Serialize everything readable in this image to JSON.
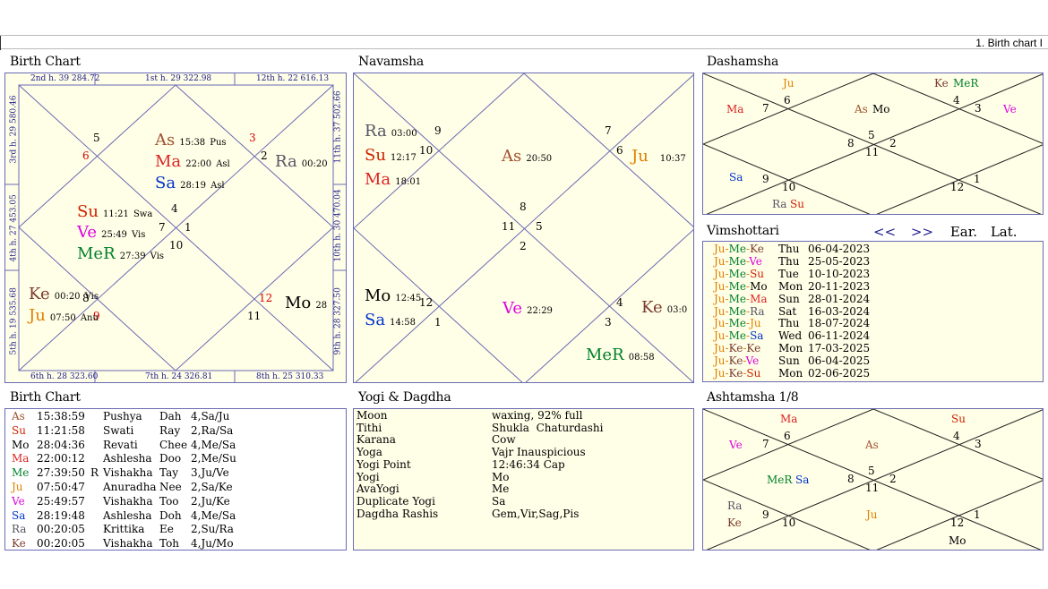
{
  "app": {
    "tab_label": "1. Birth chart I"
  },
  "colors": {
    "As": "#a0522d",
    "Su": "#cc2200",
    "Mo": "#000000",
    "Ma": "#dd2222",
    "Me": "#00802b",
    "Ju": "#e08000",
    "Ve": "#dd00dd",
    "Sa": "#0033cc",
    "Ra": "#555566",
    "Ke": "#7a3b2e",
    "house_red": "#dd0000"
  },
  "birth_chart": {
    "title": "Birth Chart",
    "edge": {
      "top_l": "2nd h. 39 284.72",
      "top_m": "1st h. 29 322.98",
      "top_r": "12th h. 22 616.13",
      "bot_l": "6th h. 28 323.60",
      "bot_m": "7th h. 24 326.81",
      "bot_r": "8th h. 25 310.33",
      "left_t": "3rd h. 29 580.46",
      "left_m": "4th h. 27 453.05",
      "left_b": "5th h. 19 535.68",
      "right_t": "11th h. 37 502.66",
      "right_m": "10th h. 30 470.04",
      "right_b": "9th h. 28 327.50"
    },
    "houses": [
      "5",
      "6",
      "3",
      "2",
      "4",
      "7",
      "1",
      "10",
      "8",
      "9",
      "12",
      "11"
    ],
    "planets": [
      {
        "name": "As",
        "deg": "15:38",
        "nak": "Pus"
      },
      {
        "name": "Ma",
        "deg": "22:00",
        "nak": "Asl"
      },
      {
        "name": "Sa",
        "deg": "28:19",
        "nak": "Asl"
      },
      {
        "name": "Ra",
        "deg": "00:20"
      },
      {
        "name": "Su",
        "deg": "11:21",
        "nak": "Swa"
      },
      {
        "name": "Ve",
        "deg": "25:49",
        "nak": "Vis"
      },
      {
        "name": "MeR",
        "deg": "27:39",
        "nak": "Vis"
      },
      {
        "name": "Ke",
        "deg": "00:20",
        "nak": "Vis"
      },
      {
        "name": "Ju",
        "deg": "07:50",
        "nak": "Anu"
      },
      {
        "name": "Mo",
        "deg": "28"
      }
    ]
  },
  "navamsha": {
    "title": "Navamsha",
    "houses": [
      "9",
      "10",
      "7",
      "6",
      "8",
      "11",
      "5",
      "2",
      "12",
      "1",
      "4",
      "3"
    ],
    "planets": [
      {
        "name": "Ra",
        "deg": "03:00"
      },
      {
        "name": "Su",
        "deg": "12:17"
      },
      {
        "name": "Ma",
        "deg": "18:01"
      },
      {
        "name": "As",
        "deg": "20:50"
      },
      {
        "name": "Ju",
        "deg": "10:37"
      },
      {
        "name": "Mo",
        "deg": "12:45"
      },
      {
        "name": "Sa",
        "deg": "14:58"
      },
      {
        "name": "Ve",
        "deg": "22:29"
      },
      {
        "name": "Ke",
        "deg": "03:0"
      },
      {
        "name": "MeR",
        "deg": "08:58"
      }
    ]
  },
  "dashamsha": {
    "title": "Dashamsha",
    "houses": [
      "6",
      "7",
      "4",
      "3",
      "5",
      "8",
      "2",
      "11",
      "9",
      "10",
      "12",
      "1"
    ],
    "planets": [
      "Ju",
      "Ke",
      "MeR",
      "Ma",
      "As",
      "Mo",
      "Ve",
      "Sa",
      "Ra",
      "Su"
    ]
  },
  "vimshottari": {
    "title": "Vimshottari",
    "nav_prev": "<<",
    "nav_next": ">>",
    "ear": "Ear.",
    "lat": "Lat.",
    "rows": [
      {
        "p": [
          "Ju",
          "Me",
          "Ke"
        ],
        "day": "Thu",
        "date": "06-04-2023"
      },
      {
        "p": [
          "Ju",
          "Me",
          "Ve"
        ],
        "day": "Thu",
        "date": "25-05-2023"
      },
      {
        "p": [
          "Ju",
          "Me",
          "Su"
        ],
        "day": "Tue",
        "date": "10-10-2023"
      },
      {
        "p": [
          "Ju",
          "Me",
          "Mo"
        ],
        "day": "Mon",
        "date": "20-11-2023"
      },
      {
        "p": [
          "Ju",
          "Me",
          "Ma"
        ],
        "day": "Sun",
        "date": "28-01-2024"
      },
      {
        "p": [
          "Ju",
          "Me",
          "Ra"
        ],
        "day": "Sat",
        "date": "16-03-2024"
      },
      {
        "p": [
          "Ju",
          "Me",
          "Ju"
        ],
        "day": "Thu",
        "date": "18-07-2024"
      },
      {
        "p": [
          "Ju",
          "Me",
          "Sa"
        ],
        "day": "Wed",
        "date": "06-11-2024"
      },
      {
        "p": [
          "Ju",
          "Ke",
          "Ke"
        ],
        "day": "Mon",
        "date": "17-03-2025"
      },
      {
        "p": [
          "Ju",
          "Ke",
          "Ve"
        ],
        "day": "Sun",
        "date": "06-04-2025"
      },
      {
        "p": [
          "Ju",
          "Ke",
          "Su"
        ],
        "day": "Mon",
        "date": "02-06-2025"
      }
    ]
  },
  "birth_table": {
    "title": "Birth Chart",
    "rows": [
      {
        "p": "As",
        "deg": "15:38:59",
        "r": "",
        "nak": "Pushya",
        "syl": "Dah",
        "pada": "4,Sa/Ju"
      },
      {
        "p": "Su",
        "deg": "11:21:58",
        "r": "",
        "nak": "Swati",
        "syl": "Ray",
        "pada": "2,Ra/Sa"
      },
      {
        "p": "Mo",
        "deg": "28:04:36",
        "r": "",
        "nak": "Revati",
        "syl": "Chee",
        "pada": "4,Me/Sa"
      },
      {
        "p": "Ma",
        "deg": "22:00:12",
        "r": "",
        "nak": "Ashlesha",
        "syl": "Doo",
        "pada": "2,Me/Su"
      },
      {
        "p": "Me",
        "deg": "27:39:50",
        "r": "R",
        "nak": "Vishakha",
        "syl": "Tay",
        "pada": "3,Ju/Ve"
      },
      {
        "p": "Ju",
        "deg": "07:50:47",
        "r": "",
        "nak": "Anuradha",
        "syl": "Nee",
        "pada": "2,Sa/Ke"
      },
      {
        "p": "Ve",
        "deg": "25:49:57",
        "r": "",
        "nak": "Vishakha",
        "syl": "Too",
        "pada": "2,Ju/Ke"
      },
      {
        "p": "Sa",
        "deg": "28:19:48",
        "r": "",
        "nak": "Ashlesha",
        "syl": "Doh",
        "pada": "4,Me/Sa"
      },
      {
        "p": "Ra",
        "deg": "00:20:05",
        "r": "",
        "nak": "Krittika",
        "syl": "Ee",
        "pada": "2,Su/Ra"
      },
      {
        "p": "Ke",
        "deg": "00:20:05",
        "r": "",
        "nak": "Vishakha",
        "syl": "Toh",
        "pada": "4,Ju/Mo"
      }
    ]
  },
  "yogi": {
    "title": "Yogi & Dagdha",
    "rows": [
      {
        "k": "Moon",
        "v": "waxing, 92% full"
      },
      {
        "k": "Tithi",
        "v": "Shukla  Chaturdashi"
      },
      {
        "k": "Karana",
        "v": "Cow"
      },
      {
        "k": "Yoga",
        "v": "Vajr Inauspicious"
      },
      {
        "k": "Yogi Point",
        "v": "12:46:34 Cap"
      },
      {
        "k": "Yogi",
        "v": "Mo"
      },
      {
        "k": "AvaYogi",
        "v": "Me"
      },
      {
        "k": "Duplicate Yogi",
        "v": "Sa"
      },
      {
        "k": "Dagdha Rashis",
        "v": "Gem,Vir,Sag,Pis"
      }
    ]
  },
  "ashtamsha": {
    "title": "Ashtamsha 1/8",
    "houses": [
      "6",
      "7",
      "4",
      "3",
      "5",
      "8",
      "2",
      "11",
      "9",
      "10",
      "12",
      "1"
    ],
    "planets": [
      "Ma",
      "Su",
      "Ve",
      "As",
      "MeR",
      "Sa",
      "Ju",
      "Ra",
      "Ke",
      "Mo"
    ]
  }
}
